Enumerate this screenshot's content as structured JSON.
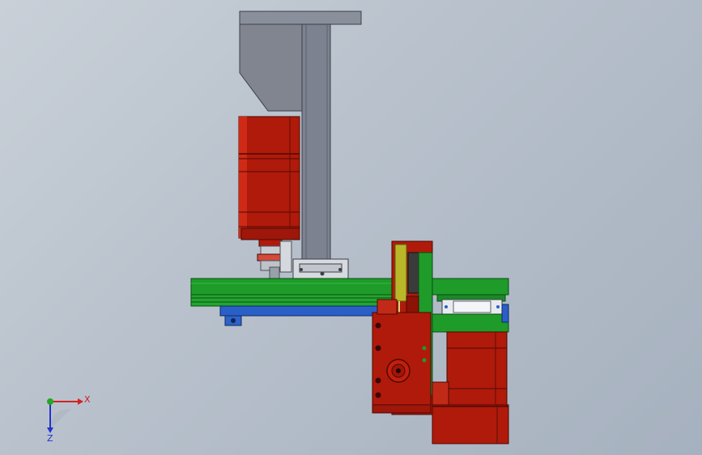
{
  "viewport": {
    "background_top": "#c9d0d8",
    "background_bottom": "#a6b1bf"
  },
  "colors": {
    "motor_red": "#b01a0a",
    "motor_red_dark": "#7d1005",
    "plate_green": "#1f9b2a",
    "plate_green_dark": "#0f6b18",
    "plate_blue": "#2a5fc7",
    "column_gray": "#7d8290",
    "column_gray_light": "#8d929f",
    "bracket_yellow": "#b9b62a",
    "rail_white": "#e8ebee"
  },
  "triad": {
    "x_label": "X",
    "z_label": "Z",
    "icon": "coordinate-triad-icon"
  }
}
